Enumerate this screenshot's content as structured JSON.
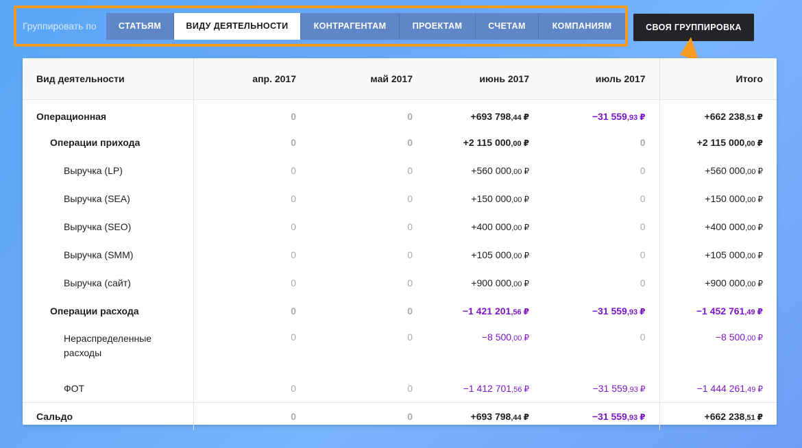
{
  "toolbar": {
    "label": "Группировать по",
    "tabs": [
      {
        "label": "СТАТЬЯМ",
        "active": false
      },
      {
        "label": "ВИДУ ДЕЯТЕЛЬНОСТИ",
        "active": true
      },
      {
        "label": "КОНТРАГЕНТАМ",
        "active": false
      },
      {
        "label": "ПРОЕКТАМ",
        "active": false
      },
      {
        "label": "СЧЕТАМ",
        "active": false
      },
      {
        "label": "КОМПАНИЯМ",
        "active": false
      }
    ],
    "custom_button": "СВОЯ ГРУППИРОВКА",
    "highlight_color": "#f59a23"
  },
  "table": {
    "headers": [
      "Вид деятельности",
      "апр. 2017",
      "май 2017",
      "июнь 2017",
      "июль 2017",
      "Итого"
    ],
    "currency": "₽",
    "rows": [
      {
        "name": "Операционная",
        "level": 0,
        "bold": true,
        "values": [
          "0",
          "0",
          "+693 798,44",
          "−31 559,93",
          "+662 238,51"
        ]
      },
      {
        "name": "Операции прихода",
        "level": 1,
        "bold": true,
        "values": [
          "0",
          "0",
          "+2 115 000,00",
          "0",
          "+2 115 000,00"
        ]
      },
      {
        "name": "Выручка (LP)",
        "level": 2,
        "bold": false,
        "values": [
          "0",
          "0",
          "+560 000,00",
          "0",
          "+560 000,00"
        ]
      },
      {
        "name": "Выручка (SEA)",
        "level": 2,
        "bold": false,
        "values": [
          "0",
          "0",
          "+150 000,00",
          "0",
          "+150 000,00"
        ]
      },
      {
        "name": "Выручка (SEO)",
        "level": 2,
        "bold": false,
        "values": [
          "0",
          "0",
          "+400 000,00",
          "0",
          "+400 000,00"
        ]
      },
      {
        "name": "Выручка (SMM)",
        "level": 2,
        "bold": false,
        "values": [
          "0",
          "0",
          "+105 000,00",
          "0",
          "+105 000,00"
        ]
      },
      {
        "name": "Выручка (сайт)",
        "level": 2,
        "bold": false,
        "values": [
          "0",
          "0",
          "+900 000,00",
          "0",
          "+900 000,00"
        ]
      },
      {
        "name": "Операции расхода",
        "level": 1,
        "bold": true,
        "values": [
          "0",
          "0",
          "−1 421 201,56",
          "−31 559,93",
          "−1 452 761,49"
        ]
      },
      {
        "name": "Нераспределенные расходы",
        "level": 2,
        "bold": false,
        "tall": true,
        "values": [
          "0",
          "0",
          "−8 500,00",
          "0",
          "−8 500,00"
        ]
      },
      {
        "name": "ФОТ",
        "level": 2,
        "bold": false,
        "values": [
          "0",
          "0",
          "−1 412 701,56",
          "−31 559,93",
          "−1 444 261,49"
        ]
      },
      {
        "name": "Сальдо",
        "level": 0,
        "bold": true,
        "saldo": true,
        "values": [
          "0",
          "0",
          "+693 798,44",
          "−31 559,93",
          "+662 238,51"
        ]
      }
    ],
    "colors": {
      "negative": "#7b16c9",
      "zero": "#a9a9a9"
    }
  }
}
